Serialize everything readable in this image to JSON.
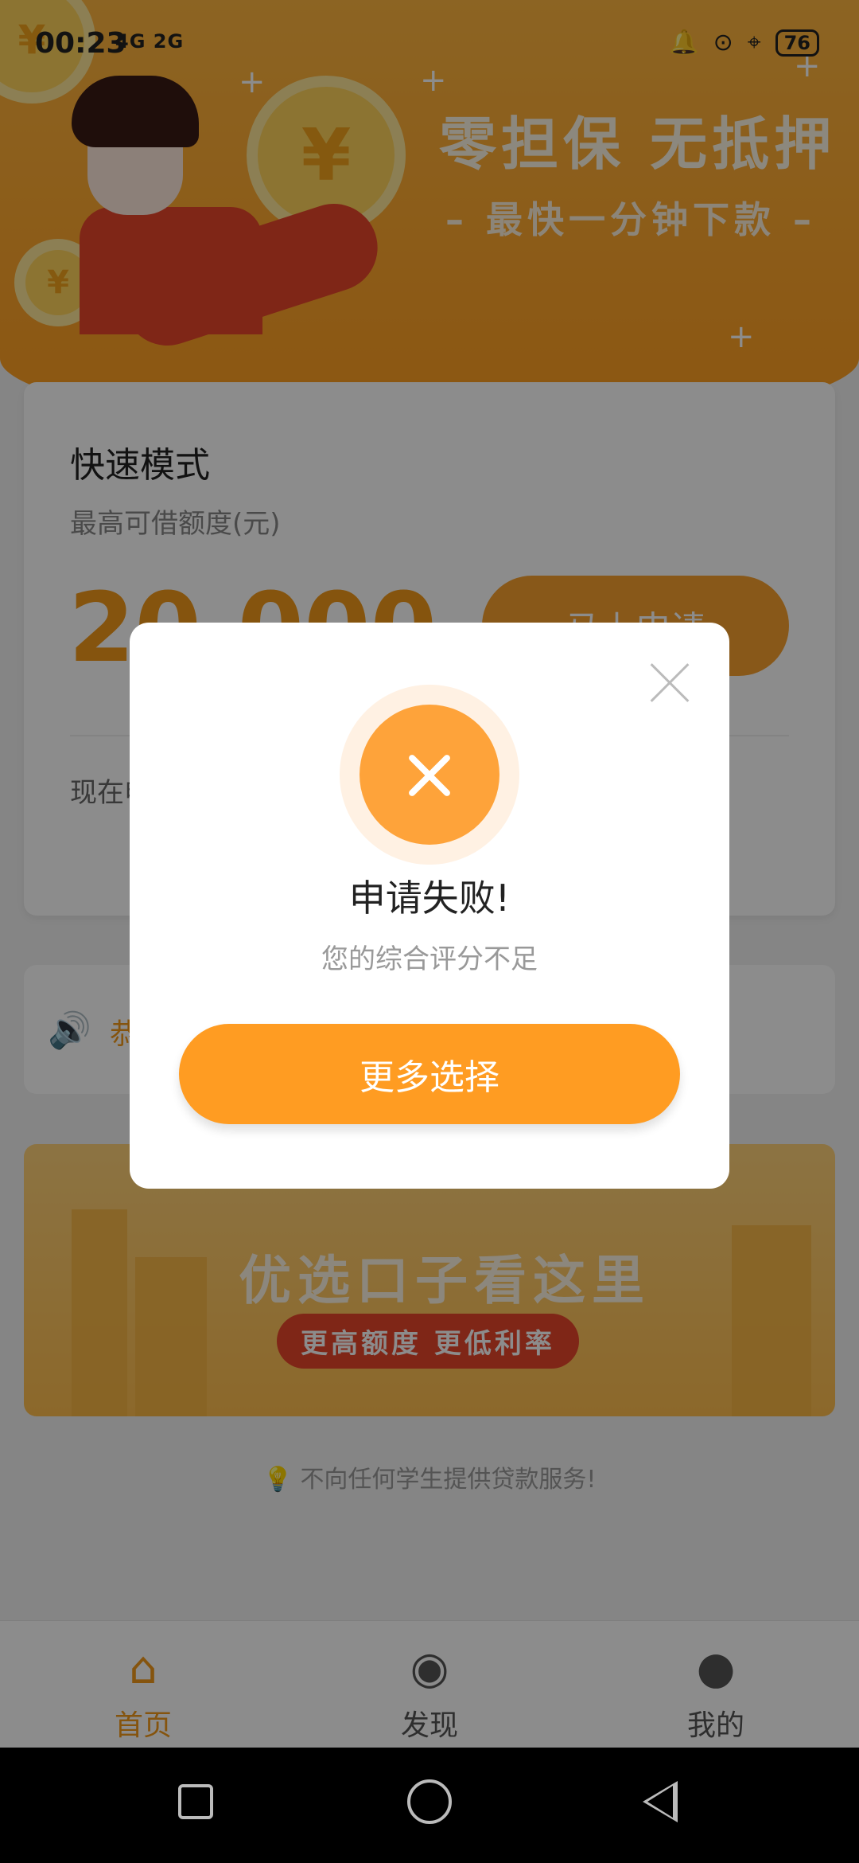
{
  "status_bar": {
    "time": "00:23",
    "network": "4G 2G",
    "battery": "76"
  },
  "hero": {
    "title": "零担保 无抵押",
    "subtitle": "– 最快一分钟下款 –"
  },
  "card": {
    "title": "快速模式",
    "limit_label": "最高可借额度(元)",
    "amount": "20,000",
    "apply_label": "马上申请",
    "note": "现在申请"
  },
  "notice": {
    "text": "恭喜"
  },
  "promo": {
    "title": "优选口子看这里",
    "pill": "更高额度 更低利率"
  },
  "footer": {
    "tip": "不向任何学生提供贷款服务!"
  },
  "nav": [
    {
      "label": "首页",
      "icon": "home-icon",
      "active": true
    },
    {
      "label": "发现",
      "icon": "compass-icon",
      "active": false
    },
    {
      "label": "我的",
      "icon": "user-icon",
      "active": false
    }
  ],
  "modal": {
    "title": "申请失败!",
    "message": "您的综合评分不足",
    "button_label": "更多选择"
  },
  "colors": {
    "accent": "#f39a1b",
    "button": "#ff9c22",
    "hero": "#ffb640"
  }
}
